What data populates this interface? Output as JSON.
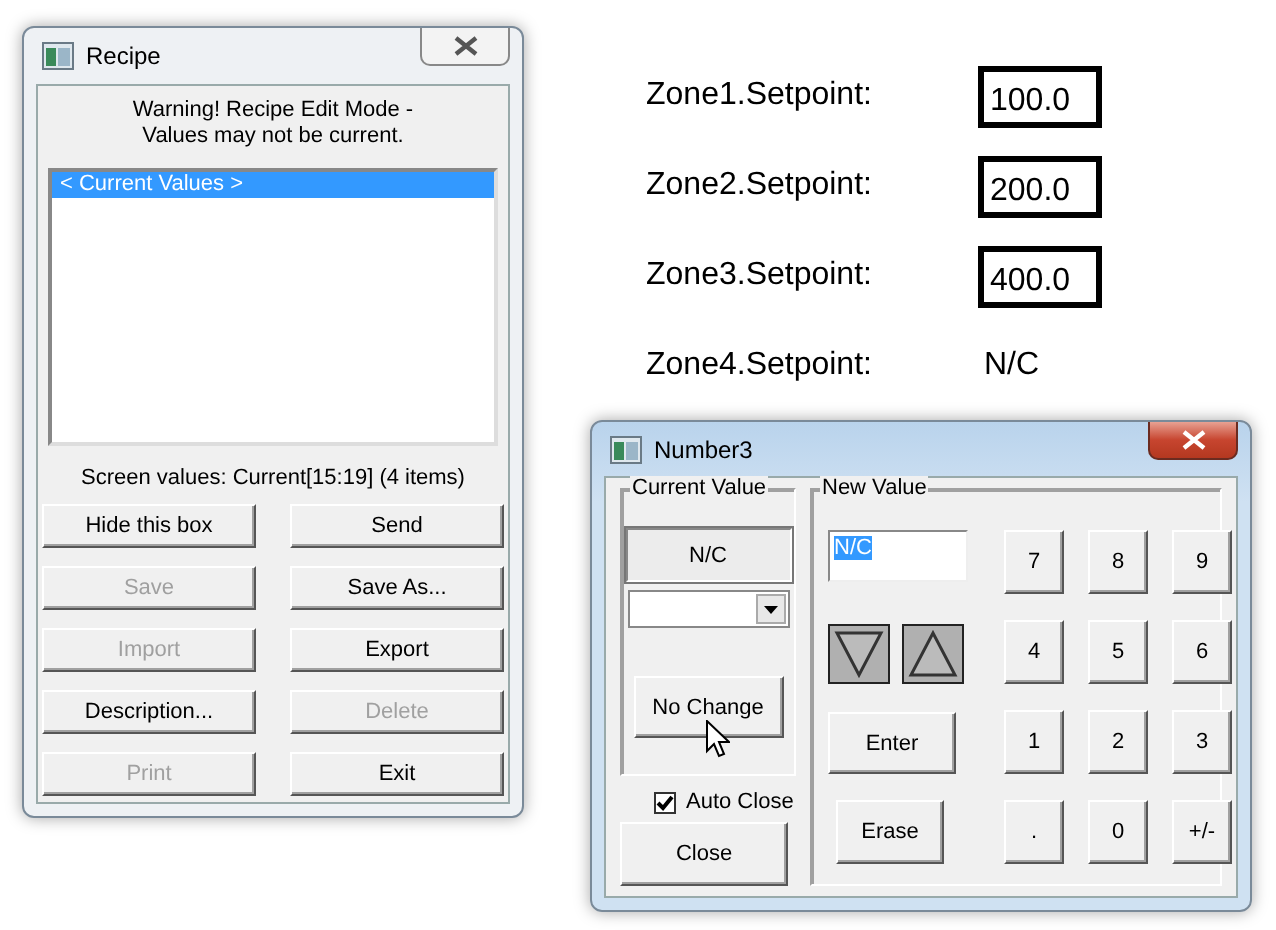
{
  "recipe_window": {
    "title": "Recipe",
    "active": false,
    "warning": [
      "Warning! Recipe Edit Mode -",
      "Values may not be current."
    ],
    "list_items": [
      {
        "label": "< Current Values >",
        "selected": true
      }
    ],
    "status": "Screen values: Current[15:19] (4 items)",
    "buttons": [
      {
        "label": "Hide this box",
        "disabled": false
      },
      {
        "label": "Send",
        "disabled": false
      },
      {
        "label": "Save",
        "disabled": true
      },
      {
        "label": "Save As...",
        "disabled": false
      },
      {
        "label": "Import",
        "disabled": true
      },
      {
        "label": "Export",
        "disabled": false
      },
      {
        "label": "Description...",
        "disabled": false
      },
      {
        "label": "Delete",
        "disabled": true
      },
      {
        "label": "Print",
        "disabled": true
      },
      {
        "label": "Exit",
        "disabled": false
      }
    ]
  },
  "zones": [
    {
      "label": "Zone1.Setpoint:",
      "value": "100.0",
      "boxed": true
    },
    {
      "label": "Zone2.Setpoint:",
      "value": "200.0",
      "boxed": true
    },
    {
      "label": "Zone3.Setpoint:",
      "value": "400.0",
      "boxed": true
    },
    {
      "label": "Zone4.Setpoint:",
      "value": "N/C",
      "boxed": false
    }
  ],
  "number_window": {
    "title": "Number3",
    "active": true,
    "current_group": {
      "title": "Current Value",
      "value": "N/C",
      "no_change_button": "No Change"
    },
    "auto_close": {
      "label": "Auto Close",
      "checked": true
    },
    "close_button": "Close",
    "new_group": {
      "title": "New Value",
      "input_value": "N/C",
      "enter_button": "Enter",
      "erase_button": "Erase",
      "keys": [
        "7",
        "8",
        "9",
        "4",
        "5",
        "6",
        "1",
        "2",
        "3",
        ".",
        "0",
        "+/-"
      ]
    }
  }
}
